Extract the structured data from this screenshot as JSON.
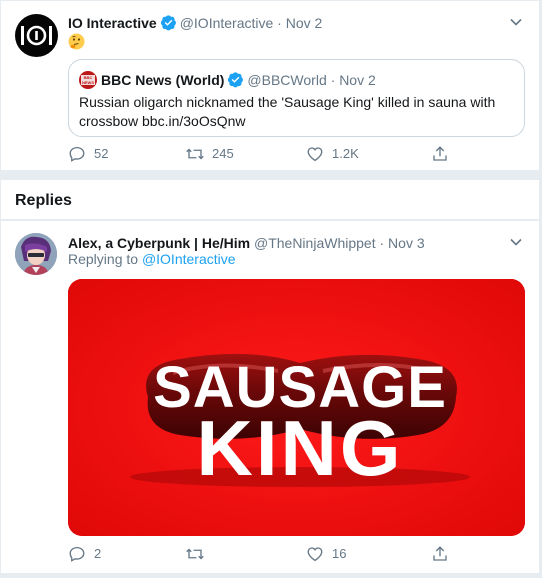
{
  "tweet": {
    "author_name": "IO Interactive",
    "author_handle": "@IOInteractive",
    "date": "Nov 2",
    "emoji": "🤔",
    "quote": {
      "author_name": "BBC News (World)",
      "author_handle": "@BBCWorld",
      "date": "Nov 2",
      "text": "Russian oligarch nicknamed the 'Sausage King' killed in sauna with crossbow bbc.in/3oOsQnw"
    },
    "counts": {
      "replies": "52",
      "retweets": "245",
      "likes": "1.2K"
    }
  },
  "replies_header": "Replies",
  "reply": {
    "author_name": "Alex, a Cyberpunk | He/Him",
    "author_handle": "@TheNinjaWhippet",
    "date": "Nov 3",
    "replying_prefix": "Replying to",
    "replying_to": "@IOInteractive",
    "image_text_line1": "SAUSAGE",
    "image_text_line2": "KING",
    "counts": {
      "replies": "2",
      "retweets": "",
      "likes": "16"
    }
  },
  "colors": {
    "verified": "#1da1f2",
    "link": "#1da1f2",
    "secondary_text": "#657786",
    "media_background": "#ee0b0b"
  },
  "icons": [
    "io-interactive-logo",
    "verified-badge-icon",
    "chevron-down-icon",
    "thinking-face-emoji",
    "bbc-news-logo",
    "reply-icon",
    "retweet-icon",
    "like-icon",
    "share-icon"
  ]
}
